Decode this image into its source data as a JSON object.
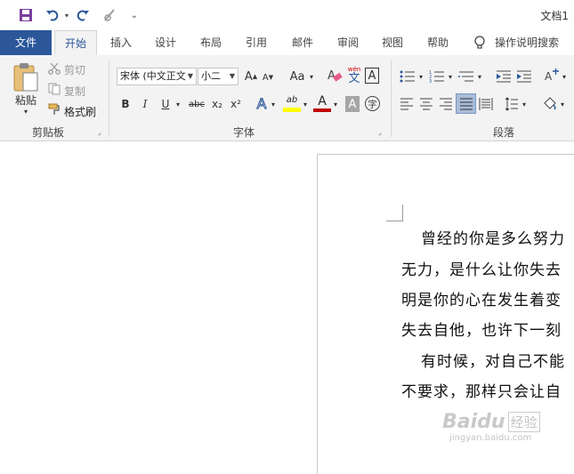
{
  "qat": {
    "title": "文档1",
    "customize": "⌄"
  },
  "tabs": [
    {
      "label": "文件"
    },
    {
      "label": "开始"
    },
    {
      "label": "插入"
    },
    {
      "label": "设计"
    },
    {
      "label": "布局"
    },
    {
      "label": "引用"
    },
    {
      "label": "邮件"
    },
    {
      "label": "审阅"
    },
    {
      "label": "视图"
    },
    {
      "label": "帮助"
    }
  ],
  "tell_me": "操作说明搜索",
  "clipboard": {
    "paste": "粘贴",
    "cut": "剪切",
    "copy": "复制",
    "format_painter": "格式刷",
    "label": "剪贴板"
  },
  "font": {
    "name": "宋体 (中文正文",
    "size": "小二",
    "grow": "A",
    "shrink": "A",
    "case": "Aa",
    "bold": "B",
    "italic": "I",
    "underline": "U",
    "strike": "abc",
    "sub": "x₂",
    "sup": "x²",
    "label": "字体",
    "pinyin": "wén",
    "charborder": "A",
    "effects": "A",
    "highlight": "ab",
    "color": "A",
    "shading": "A",
    "enclose": "字"
  },
  "paragraph": {
    "label": "段落"
  },
  "document": {
    "lines": [
      "曾经的你是多么努力",
      "无力，是什么让你失去",
      "明是你的心在发生着变",
      "失去自他，也许下一刻",
      "有时候，对自己不能",
      "不要求，那样只会让自"
    ]
  },
  "watermark": {
    "brand": "Baidu",
    "cn": "经验",
    "url": "jingyan.baidu.com"
  },
  "colors": {
    "accent": "#2b579a",
    "highlight": "#ffff00",
    "font_color": "#c00000"
  }
}
